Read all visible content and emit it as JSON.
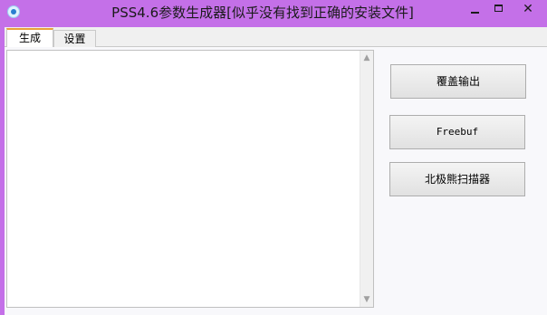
{
  "window": {
    "title": "PSS4.6参数生成器[似乎没有找到正确的安装文件]",
    "icon": "app-icon",
    "controls": {
      "minimize_icon": "minimize-icon",
      "maximize_icon": "maximize-icon",
      "close_label": "✕"
    },
    "colors": {
      "frame": "#c470e8",
      "active_tab_accent": "#e8a23a"
    }
  },
  "tabs": [
    {
      "label": "生成",
      "active": true
    },
    {
      "label": "设置",
      "active": false
    }
  ],
  "output": {
    "value": ""
  },
  "buttons": {
    "overwrite_label": "覆盖输出",
    "freebuf_label": "Freebuf",
    "scanner_label": "北极熊扫描器"
  }
}
